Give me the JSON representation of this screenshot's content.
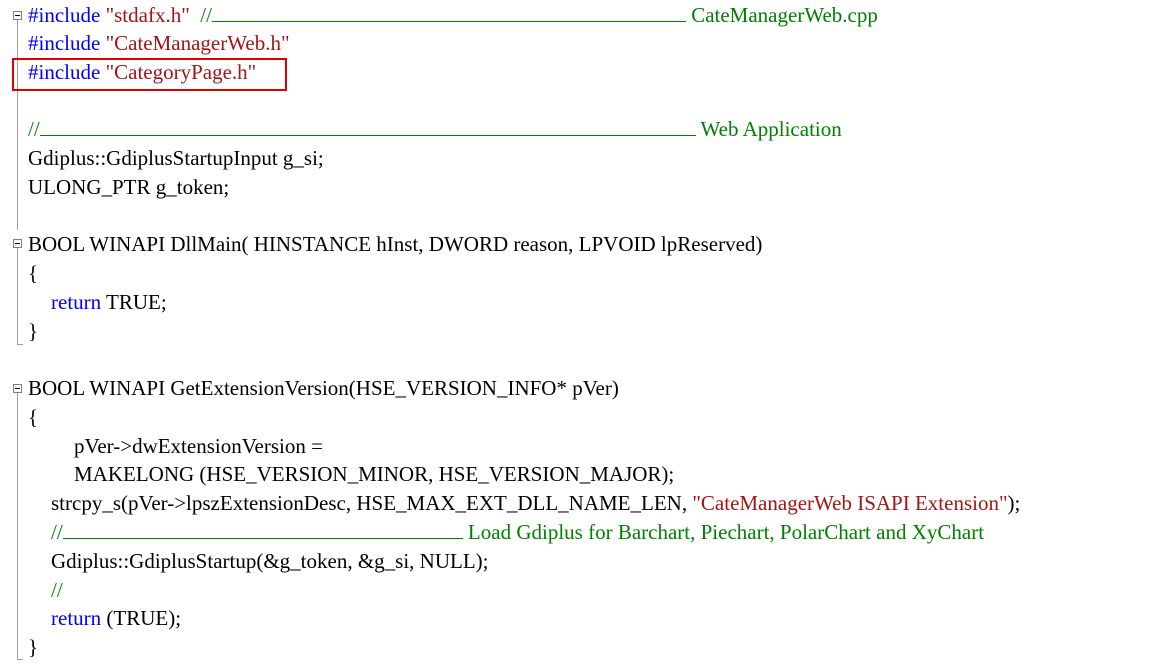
{
  "code": {
    "l1_kw": "#include",
    "l1_str": "\"stdafx.h\"",
    "l1_cmt": "//",
    "l1_title": "CateManagerWeb.cpp",
    "l2_kw": "#include",
    "l2_str": "\"CateManagerWeb.h\"",
    "l3_kw": "#include",
    "l3_str": "\"CategoryPage.h\"",
    "l5_cmt": "//",
    "l5_title": "Web Application",
    "l6": "Gdiplus::GdiplusStartupInput g_si;",
    "l7": "ULONG_PTR g_token;",
    "l9": "BOOL WINAPI DllMain( HINSTANCE hInst, DWORD reason, LPVOID lpReserved)",
    "l10": "{",
    "l11_kw": "return",
    "l11_rest": " TRUE;",
    "l12": "}",
    "l14": "BOOL WINAPI GetExtensionVersion(HSE_VERSION_INFO* pVer)",
    "l15": "{",
    "l16": "pVer->dwExtensionVersion =",
    "l17": "MAKELONG (HSE_VERSION_MINOR, HSE_VERSION_MAJOR);",
    "l18_pre": "strcpy_s(pVer->lpszExtensionDesc, HSE_MAX_EXT_DLL_NAME_LEN, ",
    "l18_str": "\"CateManagerWeb ISAPI Extension\"",
    "l18_post": ");",
    "l19_cmt": "//",
    "l19_title": "Load Gdiplus for Barchart, Piechart, PolarChart and XyChart",
    "l20": "Gdiplus::GdiplusStartup(&g_token, &g_si, NULL);",
    "l21_cmt": "//",
    "l22_kw": "return",
    "l22_rest": " (TRUE);",
    "l23": "}"
  },
  "colors": {
    "keyword": "#0000ff",
    "string": "#a31515",
    "comment": "#008000",
    "highlight": "#e00000"
  }
}
